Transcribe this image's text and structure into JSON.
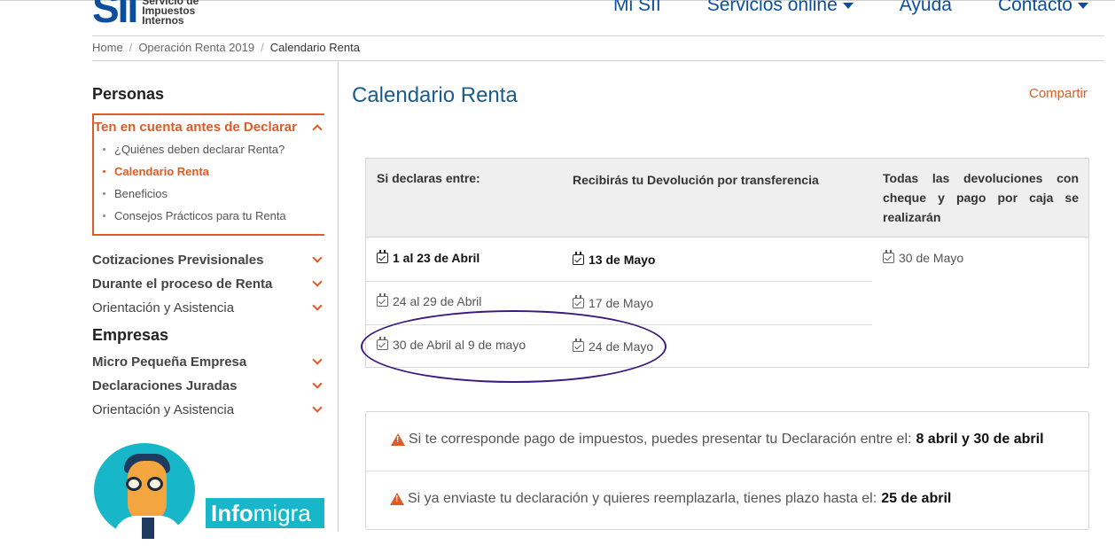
{
  "header": {
    "logo_mark": "SII",
    "logo_line1": "Servicio de",
    "logo_line2": "Impuestos",
    "logo_line3": "Internos",
    "nav": [
      "Mi SII",
      "Servicios online",
      "Ayuda",
      "Contacto"
    ]
  },
  "breadcrumb": [
    "Home",
    "Operación Renta 2019",
    "Calendario Renta"
  ],
  "sidebar": {
    "personas_title": "Personas",
    "open_section": "Ten en cuenta antes de Declarar",
    "sub_items": [
      "¿Quiénes deben declarar Renta?",
      "Calendario Renta",
      "Beneficios",
      "Consejos Prácticos para tu Renta"
    ],
    "persona_rows": [
      "Cotizaciones Previsionales",
      "Durante el proceso de Renta",
      "Orientación y Asistencia"
    ],
    "empresas_title": "Empresas",
    "empresa_rows": [
      "Micro Pequeña Empresa",
      "Declaraciones Juradas",
      "Orientación y Asistencia"
    ],
    "banner_text_a": "Info",
    "banner_text_b": "migra"
  },
  "main": {
    "title": "Calendario Renta",
    "share": "Compartir",
    "table": {
      "headers": [
        "Si declaras entre:",
        "Recibirás tu Devolución por transferencia",
        "Todas las devoluciones con cheque y pago por caja se realizarán"
      ],
      "rows": [
        {
          "period": "1 al 23 de Abril",
          "transfer": "13 de Mayo"
        },
        {
          "period": "24 al 29 de Abril",
          "transfer": "17 de Mayo"
        },
        {
          "period": "30 de Abril al 9 de mayo",
          "transfer": "24 de Mayo"
        }
      ],
      "cheque": "30 de Mayo"
    },
    "notes": [
      {
        "text": "Si te corresponde pago de impuestos, puedes presentar tu Declaración entre el:",
        "highlight": "8 abril y 30 de abril"
      },
      {
        "text": "Si ya enviaste tu declaración y quieres reemplazarla, tienes plazo hasta el:",
        "highlight": "25 de abril"
      }
    ]
  }
}
